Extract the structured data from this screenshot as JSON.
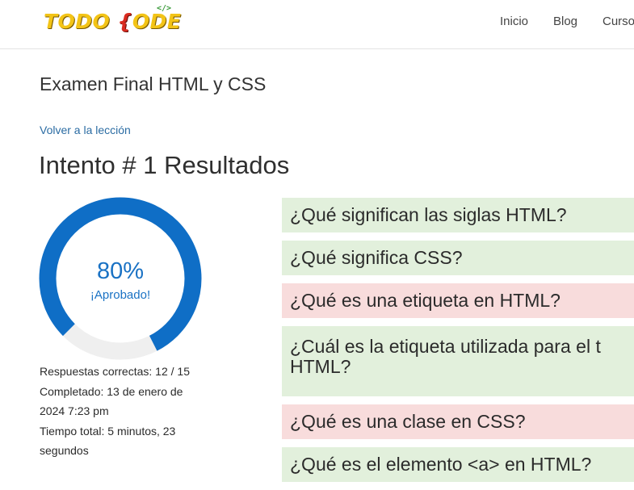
{
  "header": {
    "logo": {
      "left": "TODO ",
      "brace": "{",
      "right": "ODE",
      "tag": "</>"
    },
    "nav": [
      "Inicio",
      "Blog",
      "Cursos"
    ]
  },
  "page": {
    "exam_title": "Examen Final HTML y CSS",
    "back_link": "Volver a la lección",
    "attempt_title": "Intento # 1 Resultados"
  },
  "result": {
    "score_percent": 80,
    "score_label": "80%",
    "status": "¡Aprobado!",
    "ring_color": "#0f6ec6",
    "ring_track_color": "#efefef"
  },
  "stats": {
    "correct": "Respuestas correctas: 12 / 15",
    "completed": "Completado: 13 de enero de 2024 7:23 pm",
    "total_time": "Tiempo total: 5 minutos, 23 segundos"
  },
  "questions": [
    {
      "line1": "¿Qué significan las siglas HTML?",
      "line2": "",
      "status": "correct"
    },
    {
      "line1": "¿Qué significa CSS?",
      "line2": "",
      "status": "correct"
    },
    {
      "line1": "¿Qué es una etiqueta en HTML?",
      "line2": "",
      "status": "incorrect"
    },
    {
      "line1": "¿Cuál es la etiqueta utilizada para el t",
      "line2": "HTML?",
      "status": "correct"
    },
    {
      "line1": "¿Qué es una clase en CSS?",
      "line2": "",
      "status": "incorrect"
    },
    {
      "line1": "¿Qué es el elemento <a> en HTML?",
      "line2": "",
      "status": "correct"
    }
  ]
}
